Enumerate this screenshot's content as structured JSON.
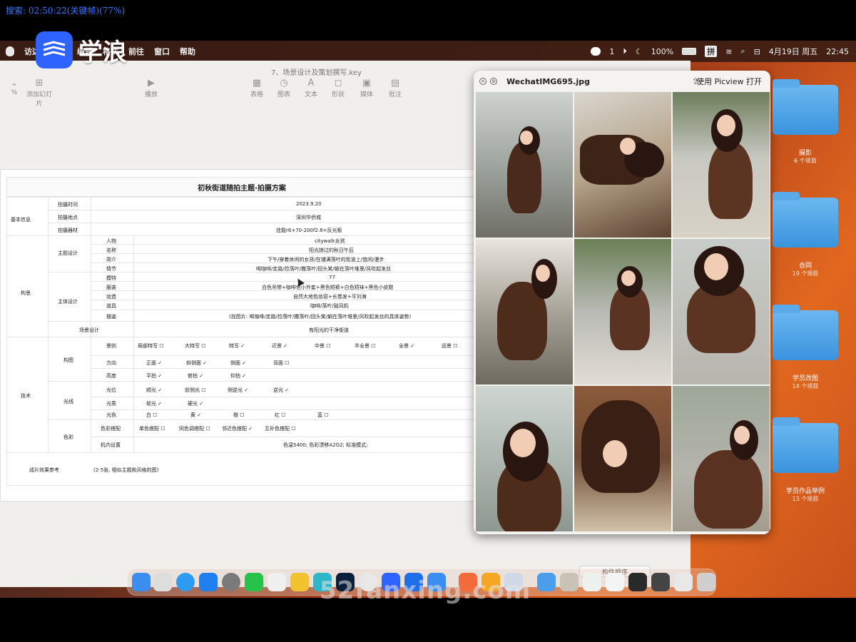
{
  "overlay": {
    "search_text": "搜索: 02:50:22(关键帧)(77%)"
  },
  "brand": {
    "logo_text": "学浪"
  },
  "menubar": {
    "items": [
      "访达",
      "编辑",
      "格式",
      "前往",
      "窗口",
      "帮助"
    ],
    "status": {
      "wechat": "1",
      "battery": "100%",
      "input": "拼",
      "date": "4月19日 周五",
      "time": "22:45"
    }
  },
  "keynote": {
    "title": "7、场景设计及策划撰写.key",
    "zoom": "%",
    "toolbar": [
      "添加幻灯片",
      "播放",
      "表格",
      "图表",
      "文本",
      "形状",
      "媒体",
      "批注"
    ]
  },
  "slide": {
    "title": "初秋街道随拍主题·拍摄方案",
    "basic": {
      "label": "基本信息",
      "rows": [
        {
          "k": "拍摄时间",
          "v": "2023.9.20"
        },
        {
          "k": "拍摄地点",
          "v": "深圳华侨城"
        },
        {
          "k": "拍摄器材",
          "v": "佳能r6+70-200f2.8+反光板"
        }
      ]
    },
    "concept": {
      "label": "构思",
      "theme_label": "主题设计",
      "theme_rows": [
        {
          "k": "人物",
          "v": "citywalk女孩"
        },
        {
          "k": "名称",
          "v": "阳光掠过的秋日午后"
        },
        {
          "k": "简介",
          "v": "下午/穿着休闲的女孩/在铺满落叶的街道上/悠闲/漫步"
        },
        {
          "k": "情节",
          "v": "喝咖啡/走路/捡落叶/撒落叶/回头笑/躺在落叶堆里/风吹起发丝"
        }
      ],
      "subject_label": "主体设计",
      "subject_rows": [
        {
          "k": "模特",
          "v": "77"
        },
        {
          "k": "服装",
          "v": "白色吊带+咖啡色小外套+黑色短裤+白色短袜+黑色小皮鞋"
        },
        {
          "k": "妆造",
          "v": "自然大地色妆容+长卷发+平刘海"
        },
        {
          "k": "道具",
          "v": "咖啡/落叶/鼓风机"
        },
        {
          "k": "摆姿",
          "v": "(找图片: 喝咖啡/走路/捡落叶/撒落叶/回头笑/躺在落叶堆里/风吹起发丝的具体姿势)"
        }
      ],
      "scene_label": "场景设计",
      "scene_value": "有阳光的干净街道"
    },
    "tech": {
      "label": "技术",
      "composition_label": "构图",
      "shot_label": "景别",
      "shots": [
        "局部特写 ☐",
        "大特写 ☐",
        "特写 ✓",
        "近景 ✓",
        "中景 ☐",
        "半全景 ☐",
        "全景 ✓",
        "远景 ☐"
      ],
      "direction_label": "方向",
      "directions": [
        "正面 ✓",
        "斜侧面 ✓",
        "侧面 ✓",
        "背面 ☐"
      ],
      "height_label": "高度",
      "heights": [
        "平拍 ✓",
        "俯拍 ✓",
        "仰拍 ✓"
      ],
      "light_label": "光线",
      "position_label": "光位",
      "positions": [
        "顺光 ✓",
        "前侧光 ☐",
        "侧逆光 ✓",
        "逆光 ✓"
      ],
      "quality_label": "光质",
      "qualities": [
        "软光 ✓",
        "硬光 ✓"
      ],
      "lcolor_label": "光色",
      "lcolors": [
        "白 ☐",
        "黄 ✓",
        "橙 ☐",
        "红 ☐",
        "蓝 ☐"
      ],
      "color_label": "色彩",
      "match_label": "色彩搭配",
      "matches": [
        "单色搭配 ☐",
        "同色调搭配 ☐",
        "邻近色搭配 ✓",
        "互补色搭配 ☐"
      ],
      "camera_label": "机内设置",
      "camera_value": "色温5400; 色彩漂移A2G2; 标准模式;"
    },
    "reference": {
      "label": "成片效果参考",
      "value": "(2-5张, 相似主题和风格的图)"
    }
  },
  "photo_window": {
    "title": "WechatIMG695.jpg",
    "open_with": "使用 Picview 打开"
  },
  "order_button": "构件顺序",
  "folders": [
    {
      "name": "摄影",
      "count": "6 个项目"
    },
    {
      "name": "合同",
      "count": "19 个项目"
    },
    {
      "name": "学员改图",
      "count": "14 个项目"
    },
    {
      "name": "学员作品举例",
      "count": "13 个项目"
    }
  ],
  "watermark": "52fanxing.com"
}
